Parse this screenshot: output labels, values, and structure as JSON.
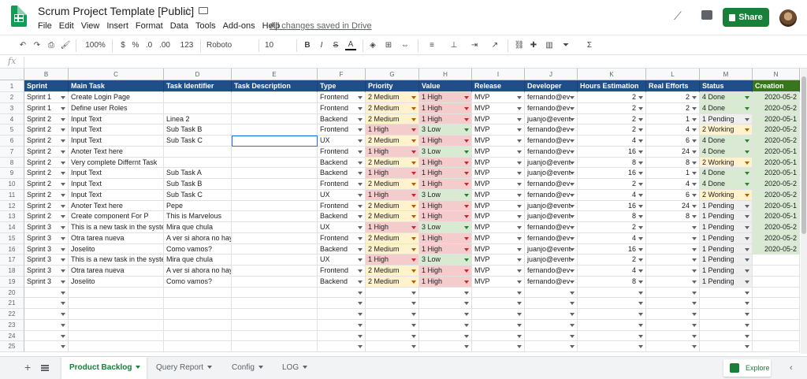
{
  "app": {
    "title": "Scrum Project Template [Public]",
    "menu": [
      "File",
      "Edit",
      "View",
      "Insert",
      "Format",
      "Data",
      "Tools",
      "Add-ons",
      "Help"
    ],
    "saved_status": "All changes saved in Drive",
    "share_label": "Share"
  },
  "toolbar": {
    "zoom": "100%",
    "currency": "$",
    "percent": "%",
    "dec_dec": ".0",
    "dec_inc": ".00",
    "number_format": "123",
    "font": "Roboto",
    "font_size": "10",
    "bold": "B",
    "italic": "I",
    "strike": "S",
    "text_color": "A",
    "sigma": "Σ"
  },
  "formula": {
    "fx": "fx"
  },
  "columns": [
    {
      "letter": "B"
    },
    {
      "letter": "C"
    },
    {
      "letter": "D"
    },
    {
      "letter": "E"
    },
    {
      "letter": "F"
    },
    {
      "letter": "G"
    },
    {
      "letter": "H"
    },
    {
      "letter": "I"
    },
    {
      "letter": "J"
    },
    {
      "letter": "K"
    },
    {
      "letter": "L"
    },
    {
      "letter": "M"
    },
    {
      "letter": "N"
    }
  ],
  "headers": [
    "Sprint",
    "Main Task",
    "Task Identifier",
    "Task Description",
    "Type",
    "Priority",
    "Value",
    "Release",
    "Developer",
    "Hours Estimation",
    "Real Efforts",
    "Status",
    "Creation"
  ],
  "rows": [
    [
      "Sprint 1",
      "Create Login Page",
      "",
      "",
      "Frontend",
      "2 Medium",
      "1 High",
      "MVP",
      "fernando@ev",
      "2",
      "2",
      "4 Done",
      "2020-05-2"
    ],
    [
      "Sprint 1",
      "Define user Roles",
      "",
      "",
      "Frontend",
      "2 Medium",
      "1 High",
      "MVP",
      "fernando@ev",
      "2",
      "2",
      "4 Done",
      "2020-05-2"
    ],
    [
      "Sprint 2",
      "Input Text",
      "Linea 2",
      "",
      "Backend",
      "2 Medium",
      "1 High",
      "MVP",
      "juanjo@event",
      "2",
      "1",
      "1 Pending",
      "2020-05-1"
    ],
    [
      "Sprint 2",
      "Input Text",
      "Sub Task B",
      "",
      "Frontend",
      "1 High",
      "3 Low",
      "MVP",
      "fernando@ev",
      "2",
      "4",
      "2 Working",
      "2020-05-2"
    ],
    [
      "Sprint 2",
      "Input Text",
      "Sub Task C",
      "",
      "UX",
      "2 Medium",
      "1 High",
      "MVP",
      "fernando@ev",
      "4",
      "6",
      "4 Done",
      "2020-05-2"
    ],
    [
      "Sprint 2",
      "Anoter Text here",
      "",
      "",
      "Frontend",
      "1 High",
      "3 Low",
      "MVP",
      "fernando@ev",
      "16",
      "24",
      "4 Done",
      "2020-05-1"
    ],
    [
      "Sprint 2",
      "Very complete Differnt Task",
      "",
      "",
      "Backend",
      "2 Medium",
      "1 High",
      "MVP",
      "juanjo@event",
      "8",
      "8",
      "2 Working",
      "2020-05-1"
    ],
    [
      "Sprint 2",
      "Input Text",
      "Sub Task A",
      "",
      "Backend",
      "1 High",
      "1 High",
      "MVP",
      "juanjo@event",
      "16",
      "1",
      "4 Done",
      "2020-05-1"
    ],
    [
      "Sprint 2",
      "Input Text",
      "Sub Task B",
      "",
      "Frontend",
      "2 Medium",
      "1 High",
      "MVP",
      "fernando@ev",
      "2",
      "4",
      "4 Done",
      "2020-05-2"
    ],
    [
      "Sprint 2",
      "Input Text",
      "Sub Task C",
      "",
      "UX",
      "1 High",
      "3 Low",
      "MVP",
      "fernando@ev",
      "4",
      "6",
      "2 Working",
      "2020-05-2"
    ],
    [
      "Sprint 2",
      "Anoter Text here",
      "Pepe",
      "",
      "Frontend",
      "2 Medium",
      "1 High",
      "MVP",
      "juanjo@event",
      "16",
      "24",
      "1 Pending",
      "2020-05-1"
    ],
    [
      "Sprint 2",
      "Create component For P",
      "This is Marvelous",
      "",
      "Backend",
      "2 Medium",
      "1 High",
      "MVP",
      "juanjo@event",
      "8",
      "8",
      "1 Pending",
      "2020-05-1"
    ],
    [
      "Sprint 3",
      "This is a new task in the system",
      "Mira que chula",
      "",
      "UX",
      "1 High",
      "3 Low",
      "MVP",
      "fernando@ev",
      "2",
      "",
      "1 Pending",
      "2020-05-2"
    ],
    [
      "Sprint 3",
      "Otra tarea nueva",
      "A ver si ahora no hay log",
      "",
      "Frontend",
      "2 Medium",
      "1 High",
      "MVP",
      "fernando@ev",
      "4",
      "",
      "1 Pending",
      "2020-05-2"
    ],
    [
      "Sprint 3",
      "Joselito",
      "Como vamos?",
      "",
      "Backend",
      "2 Medium",
      "1 High",
      "MVP",
      "juanjo@event",
      "16",
      "",
      "1 Pending",
      "2020-05-2"
    ],
    [
      "Sprint 3",
      "This is a new task in the system",
      "Mira que chula",
      "",
      "UX",
      "1 High",
      "3 Low",
      "MVP",
      "juanjo@event",
      "2",
      "",
      "1 Pending",
      ""
    ],
    [
      "Sprint 3",
      "Otra tarea nueva",
      "A ver si ahora no hay log",
      "",
      "Frontend",
      "2 Medium",
      "1 High",
      "MVP",
      "fernando@ev",
      "4",
      "",
      "1 Pending",
      ""
    ],
    [
      "Sprint 3",
      "Joselito",
      "Como vamos?",
      "",
      "Backend",
      "2 Medium",
      "1 High",
      "MVP",
      "fernando@ev",
      "8",
      "",
      "1 Pending",
      ""
    ]
  ],
  "row_numbers": [
    "1",
    "2",
    "3",
    "4",
    "5",
    "6",
    "7",
    "8",
    "9",
    "10",
    "11",
    "12",
    "13",
    "14",
    "15",
    "16",
    "17",
    "18",
    "19",
    "20",
    "21",
    "22",
    "23",
    "24",
    "25"
  ],
  "colors": {
    "header_blue": "#1f4e89",
    "header_green": "#38761d",
    "medium_bg": "#fff2cc",
    "high_bg": "#f4cccc",
    "low_bg": "#d9ead3",
    "done_bg": "#d9ead3",
    "working_bg": "#fff2cc",
    "pending_bg": "#efefef",
    "creation_bg": "#d9ead3",
    "accent": "#188038"
  },
  "sheets": {
    "tabs": [
      {
        "label": "Product Backlog",
        "active": true
      },
      {
        "label": "Query Report",
        "active": false
      },
      {
        "label": "Config",
        "active": false
      },
      {
        "label": "LOG",
        "active": false
      }
    ],
    "explore_label": "Explore"
  }
}
